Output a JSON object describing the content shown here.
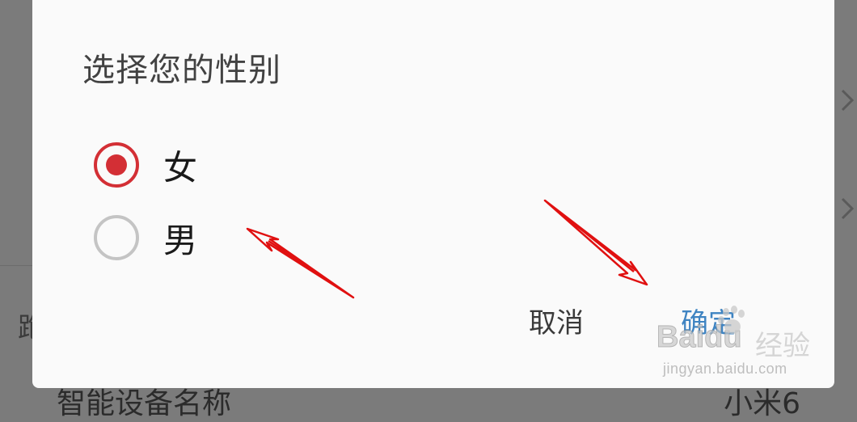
{
  "background": {
    "left_text": "跑",
    "bottom_row_text": "智能设备名称",
    "bottom_row_value": "小米6"
  },
  "dialog": {
    "title": "选择您的性别",
    "options": [
      {
        "label": "女",
        "checked": true
      },
      {
        "label": "男",
        "checked": false
      }
    ],
    "cancel_label": "取消",
    "ok_label": "确定"
  },
  "watermark": {
    "logo": "Baidu",
    "text": "经验",
    "url": "jingyan.baidu.com"
  },
  "colors": {
    "accent_red": "#d32f35",
    "ok_blue": "#3f84c2",
    "annotation_arrow": "#e01010"
  },
  "icons": {
    "background_rows": "chevron-right-icon",
    "annotations": "arrow-icon",
    "watermark": "paw-icon"
  }
}
